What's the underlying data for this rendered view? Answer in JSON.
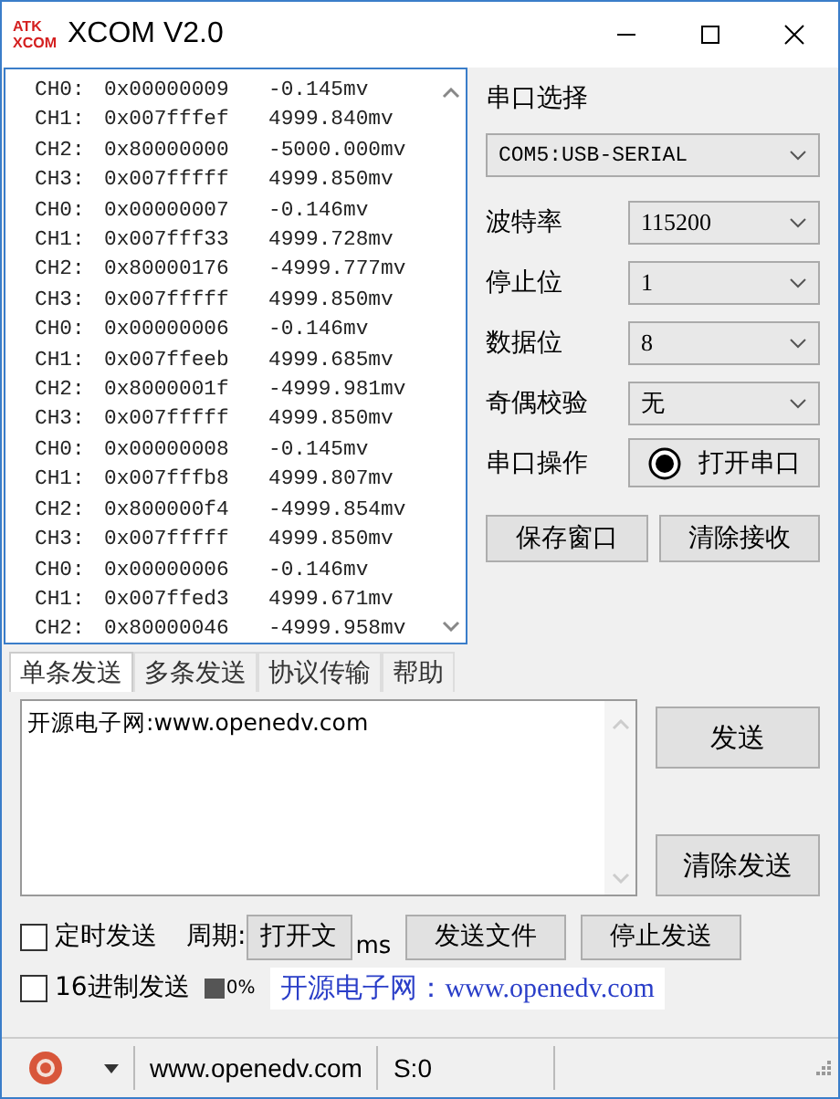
{
  "window": {
    "title": "XCOM V2.0",
    "logo_top": "ATK",
    "logo_bottom": "XCOM"
  },
  "receive": {
    "lines": [
      {
        "channel": "CH0:",
        "hex": "0x00000009",
        "value": "-0.145mv"
      },
      {
        "channel": "CH1:",
        "hex": "0x007fffef",
        "value": "4999.840mv"
      },
      {
        "channel": "CH2:",
        "hex": "0x80000000",
        "value": "-5000.000mv"
      },
      {
        "channel": "CH3:",
        "hex": "0x007fffff",
        "value": "4999.850mv"
      },
      {
        "channel": "CH0:",
        "hex": "0x00000007",
        "value": "-0.146mv"
      },
      {
        "channel": "CH1:",
        "hex": "0x007fff33",
        "value": "4999.728mv"
      },
      {
        "channel": "CH2:",
        "hex": "0x80000176",
        "value": "-4999.777mv"
      },
      {
        "channel": "CH3:",
        "hex": "0x007fffff",
        "value": "4999.850mv"
      },
      {
        "channel": "CH0:",
        "hex": "0x00000006",
        "value": "-0.146mv"
      },
      {
        "channel": "CH1:",
        "hex": "0x007ffeeb",
        "value": "4999.685mv"
      },
      {
        "channel": "CH2:",
        "hex": "0x8000001f",
        "value": "-4999.981mv"
      },
      {
        "channel": "CH3:",
        "hex": "0x007fffff",
        "value": "4999.850mv"
      },
      {
        "channel": "CH0:",
        "hex": "0x00000008",
        "value": "-0.145mv"
      },
      {
        "channel": "CH1:",
        "hex": "0x007fffb8",
        "value": "4999.807mv"
      },
      {
        "channel": "CH2:",
        "hex": "0x800000f4",
        "value": "-4999.854mv"
      },
      {
        "channel": "CH3:",
        "hex": "0x007fffff",
        "value": "4999.850mv"
      },
      {
        "channel": "CH0:",
        "hex": "0x00000006",
        "value": "-0.146mv"
      },
      {
        "channel": "CH1:",
        "hex": "0x007ffed3",
        "value": "4999.671mv"
      },
      {
        "channel": "CH2:",
        "hex": "0x80000046",
        "value": "-4999.958mv"
      }
    ]
  },
  "settings": {
    "port_label": "串口选择",
    "port_value": "COM5:USB-SERIAL",
    "fields": [
      {
        "label": "波特率",
        "value": "115200"
      },
      {
        "label": "停止位",
        "value": "1"
      },
      {
        "label": "数据位",
        "value": "8"
      },
      {
        "label": "奇偶校验",
        "value": "无"
      }
    ],
    "operation_label": "串口操作",
    "operation_button": "打开串口",
    "port_open": false,
    "buttons": [
      "保存窗口",
      "清除接收"
    ]
  },
  "tabs": [
    {
      "label": "单条发送",
      "selected": true
    },
    {
      "label": "多条发送",
      "selected": false
    },
    {
      "label": "协议传输",
      "selected": false
    },
    {
      "label": "帮助",
      "selected": false
    }
  ],
  "send": {
    "text": "开源电子网:www.openedv.com",
    "buttons": [
      "发送",
      "清除发送"
    ]
  },
  "options": {
    "timed_send": {
      "label": "定时发送",
      "checked": false
    },
    "period_label": "周期:",
    "open_file": "打开文",
    "unit": "ms",
    "send_file": "发送文件",
    "stop_send": "停止发送",
    "hex_send": {
      "label": "16进制发送",
      "checked": false
    },
    "newline": {
      "label": "0%",
      "checked": true
    },
    "banner": "开源电子网：www.openedv.com"
  },
  "status_bar": {
    "url": "www.openedv.com",
    "sent": "S:0"
  }
}
